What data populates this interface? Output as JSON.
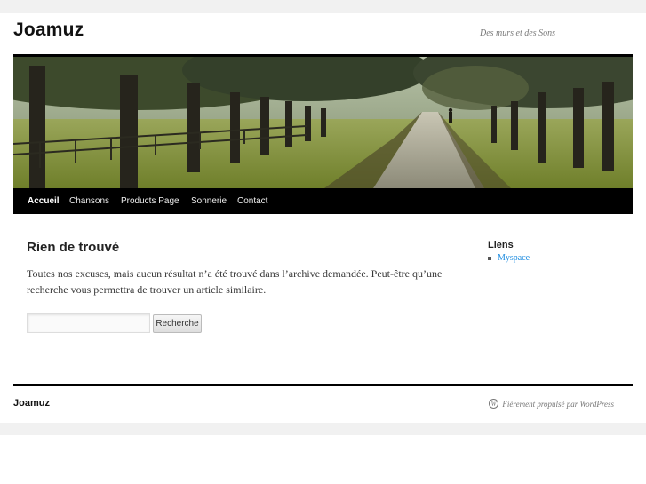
{
  "header": {
    "site_title": "Joamuz",
    "site_description": "Des murs et des Sons"
  },
  "nav": {
    "items": [
      {
        "label": "Accueil",
        "active": true
      },
      {
        "label": "Chansons",
        "active": false
      },
      {
        "label": "Products Page",
        "active": false
      },
      {
        "label": "Sonnerie",
        "active": false
      },
      {
        "label": "Contact",
        "active": false
      }
    ]
  },
  "main": {
    "title": "Rien de trouvé",
    "message": "Toutes nos excuses, mais aucun résultat n’a été trouvé dans l’archive demandée. Peut-être qu’une recherche vous permettra de trouver un article similaire.",
    "search": {
      "value": "",
      "placeholder": "",
      "button_label": "Recherche"
    }
  },
  "sidebar": {
    "widget_title": "Liens",
    "links": [
      "Myspace"
    ]
  },
  "footer": {
    "site_title": "Joamuz",
    "credit": "Fièrement propulsé par WordPress"
  },
  "colors": {
    "link": "#1b8be0",
    "nav_background": "#000000",
    "band": "#f1f1f1"
  }
}
